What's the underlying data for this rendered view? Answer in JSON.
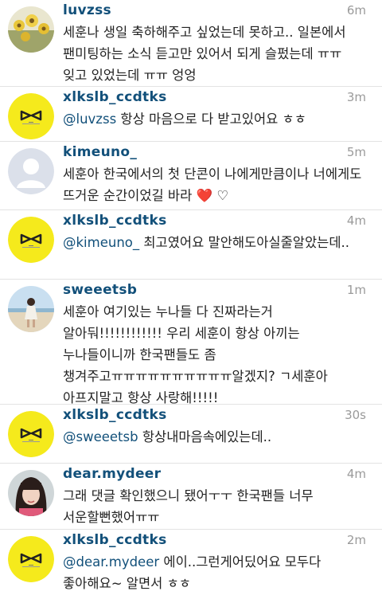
{
  "comments": [
    {
      "username": "luvzss",
      "time": "6m",
      "avatar": "sunflower-photo-avatar",
      "mention": "",
      "text": "세훈나 생일 축하해주고 싶었는데 못하고.. 일본에서 팬미팅하는 소식 듣고만 있어서 되게 슬펐는데 ㅠㅠ 잊고 있었는데 ㅠㅠ 엉엉"
    },
    {
      "username": "xlkslb_ccdtks",
      "time": "3m",
      "avatar": "yellow-bow-logo-avatar",
      "mention": "@luvzss",
      "text": " 항상 마음으로 다 받고있어요 ㅎㅎ"
    },
    {
      "username": "kimeuno_",
      "time": "5m",
      "avatar": "default-person-avatar",
      "mention": "",
      "text": "세훈아 한국에서의 첫 단콘이 나에게만큼이나 너에게도 뜨거운 순간이었길 바라 ❤️ ♡"
    },
    {
      "username": "xlkslb_ccdtks",
      "time": "4m",
      "avatar": "yellow-bow-logo-avatar",
      "mention": "@kimeuno_",
      "text": " 최고였어요 말안해도아실줄알았는데.."
    },
    {
      "username": "sweeetsb",
      "time": "1m",
      "avatar": "beach-photo-avatar",
      "mention": "",
      "text": "세훈아 여기있는 누나들 다 진짜라는거 알아둬!!!!!!!!!!!! 우리 세훈이 항상 아끼는 누나들이니까 한국팬들도 좀 챙겨주고ㅠㅠㅠㅠㅠㅠㅠㅠㅠㅠ알겠지? ㄱ세훈아 아프지말고 항상 사랑해!!!!!"
    },
    {
      "username": "xlkslb_ccdtks",
      "time": "30s",
      "avatar": "yellow-bow-logo-avatar",
      "mention": "@sweeetsb",
      "text": " 항상내마음속에있는데.."
    },
    {
      "username": "dear.mydeer",
      "time": "4m",
      "avatar": "girl-portrait-avatar",
      "mention": "",
      "text": "그래 댓글 확인했으니 됐어ㅜㅜ 한국팬들 너무 서운할뻔했어ㅠㅠ"
    },
    {
      "username": "xlkslb_ccdtks",
      "time": "2m",
      "avatar": "yellow-bow-logo-avatar",
      "mention": "@dear.mydeer",
      "text": " 에이..그런게어딨어요 모두다 좋아해요~ 알면서 ㅎㅎ"
    }
  ]
}
